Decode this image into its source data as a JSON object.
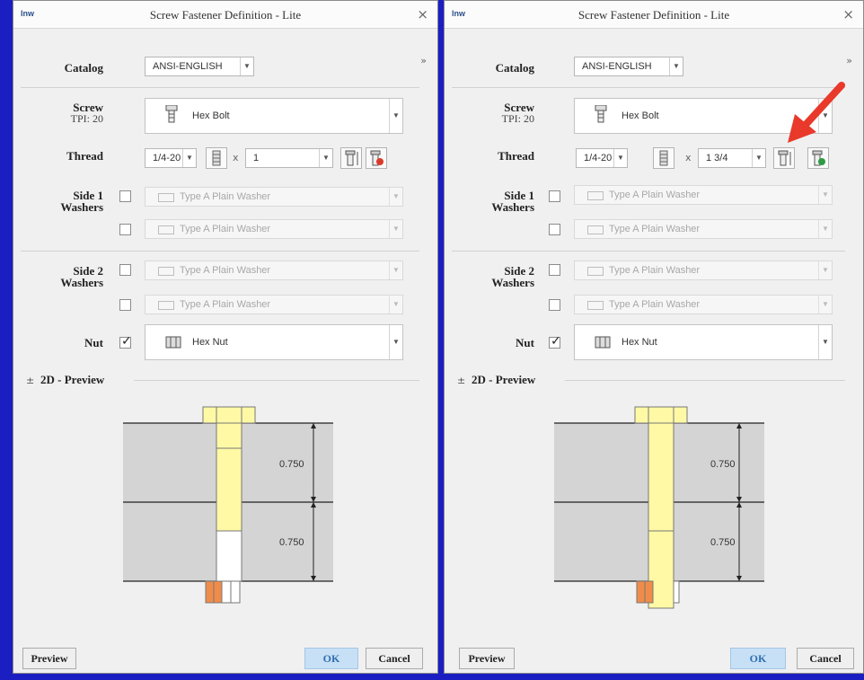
{
  "dialogs": [
    {
      "title": "Screw Fastener Definition - Lite",
      "logo": "lnw",
      "catalog_label": "Catalog",
      "catalog_value": "ANSI-ENGLISH",
      "screw_label": "Screw",
      "screw_tpi": "TPI: 20",
      "screw_value": "Hex Bolt",
      "thread_label": "Thread",
      "thread_size": "1/4-20",
      "thread_x": "x",
      "thread_length": "1",
      "side1_label_1": "Side 1",
      "side1_label_2": "Washers",
      "side1_washer_a": "Type A Plain Washer",
      "side1_washer_b": "Type A Plain Washer",
      "side2_label_1": "Side 2",
      "side2_label_2": "Washers",
      "side2_washer_a": "Type A Plain Washer",
      "side2_washer_b": "Type A Plain Washer",
      "nut_label": "Nut",
      "nut_checked": true,
      "nut_value": "Hex Nut",
      "preview_header": "2D - Preview",
      "dim_top": "0.750",
      "dim_bottom": "0.750",
      "preview_button": "Preview",
      "ok_button": "OK",
      "cancel_button": "Cancel"
    },
    {
      "title": "Screw Fastener Definition - Lite",
      "logo": "lnw",
      "catalog_label": "Catalog",
      "catalog_value": "ANSI-ENGLISH",
      "screw_label": "Screw",
      "screw_tpi": "TPI: 20",
      "screw_value": "Hex Bolt",
      "thread_label": "Thread",
      "thread_size": "1/4-20",
      "thread_x": "x",
      "thread_length": "1 3/4",
      "side1_label_1": "Side 1",
      "side1_label_2": "Washers",
      "side1_washer_a": "Type A Plain Washer",
      "side1_washer_b": "Type A Plain Washer",
      "side2_label_1": "Side 2",
      "side2_label_2": "Washers",
      "side2_washer_a": "Type A Plain Washer",
      "side2_washer_b": "Type A Plain Washer",
      "nut_label": "Nut",
      "nut_checked": true,
      "nut_value": "Hex Nut",
      "preview_header": "2D - Preview",
      "dim_top": "0.750",
      "dim_bottom": "0.750",
      "preview_button": "Preview",
      "ok_button": "OK",
      "cancel_button": "Cancel"
    }
  ],
  "icons": {
    "close": "close-icon",
    "expand": "chevron-double-right-icon",
    "collapse": "collapse-icon",
    "annotation": "red-arrow-icon"
  },
  "colors": {
    "background": "#1b1fc2",
    "bolt_fill": "#fff9a6",
    "nut_fill": "#f08c4a",
    "plate_fill": "#d4d4d4",
    "arrow": "#e8392b"
  }
}
